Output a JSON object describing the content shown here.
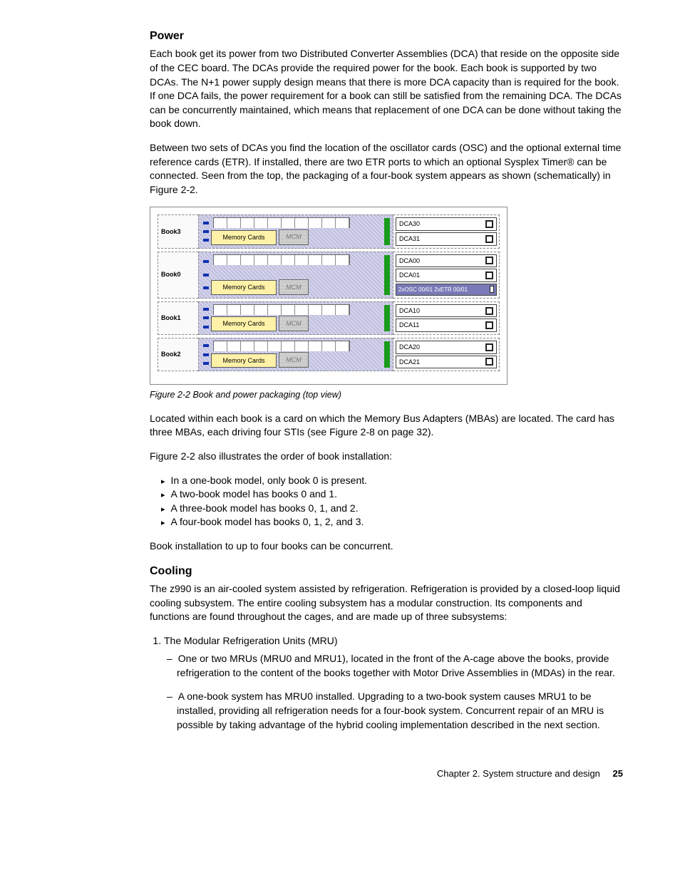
{
  "sections": {
    "power": {
      "heading": "Power",
      "para1": "Each book get its power from two Distributed Converter Assemblies (DCA) that reside on the opposite side of the CEC board. The DCAs provide the required power for the book. Each book is supported by two DCAs. The N+1 power supply design means that there is more DCA capacity than is required for the book. If one DCA fails, the power requirement for a book can still be satisfied from the remaining DCA. The DCAs can be concurrently maintained, which means that replacement of one DCA can be done without taking the book down.",
      "para2": "Between two sets of DCAs you find the location of the oscillator cards (OSC) and the optional external time reference cards (ETR). If installed, there are two ETR ports to which an optional Sysplex Timer® can be connected. Seen from the top, the packaging of a four-book system appears as shown (schematically) in Figure 2-2."
    },
    "figure": {
      "caption": "Figure 2-2   Book and power packaging (top view)",
      "mem_label": "Memory Cards",
      "mcm_label": "MCM",
      "osc_label": "2xOSC 00/01 2xETR 00/01",
      "rows": [
        {
          "book": "Book3",
          "dca": [
            "DCA30",
            "DCA31"
          ],
          "osc": false
        },
        {
          "book": "Book0",
          "dca": [
            "DCA00",
            "DCA01"
          ],
          "osc": true
        },
        {
          "book": "Book1",
          "dca": [
            "DCA10",
            "DCA11"
          ],
          "osc": false
        },
        {
          "book": "Book2",
          "dca": [
            "DCA20",
            "DCA21"
          ],
          "osc": false
        }
      ]
    },
    "after_fig": {
      "para1": "Located within each book is a card on which the Memory Bus Adapters (MBAs) are located. The card has three MBAs, each driving four STIs (see Figure 2-8 on page 32).",
      "para2": "Figure 2-2 also illustrates the order of book installation:",
      "bullets": [
        "In a one-book model, only book 0 is present.",
        "A two-book model has books 0 and 1.",
        "A three-book model has books 0, 1, and 2.",
        "A four-book model has books 0, 1, 2, and 3."
      ],
      "para3": "Book installation to up to four books can be concurrent."
    },
    "cooling": {
      "heading": "Cooling",
      "para1": "The z990 is an air-cooled system assisted by refrigeration. Refrigeration is provided by a closed-loop liquid cooling subsystem. The entire cooling subsystem has a modular construction. Its components and functions are found throughout the cages, and are made up of three subsystems:",
      "ol_item1": "The Modular Refrigeration Units (MRU)",
      "sub1": "One or two MRUs (MRU0 and MRU1), located in the front of the A-cage above the books, provide refrigeration to the content of the books together with Motor Drive Assemblies in (MDAs) in the rear.",
      "sub2": "A one-book system has MRU0 installed. Upgrading to a two-book system causes MRU1 to be installed, providing all refrigeration needs for a four-book system. Concurrent repair of an MRU is possible by taking advantage of the hybrid cooling implementation described in the next section."
    }
  },
  "footer": {
    "chapter": "Chapter 2. System structure and design",
    "page": "25"
  }
}
